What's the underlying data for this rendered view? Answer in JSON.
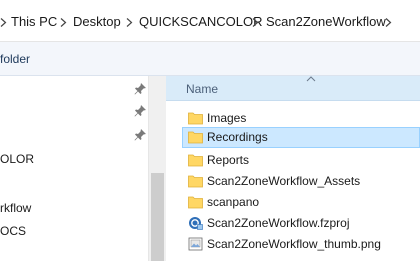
{
  "breadcrumb": [
    "This PC",
    "Desktop",
    "QUICKSCANCOLOR",
    "Scan2ZoneWorkflow"
  ],
  "command_bar": {
    "label": "folder"
  },
  "nav": {
    "items": [
      "OLOR",
      "rkflow",
      "OCS"
    ]
  },
  "file_list": {
    "column_header": "Name",
    "sort": "ascending",
    "items": [
      {
        "name": "Images",
        "icon": "folder-icon",
        "selected": false
      },
      {
        "name": "Recordings",
        "icon": "folder-icon",
        "selected": true
      },
      {
        "name": "Reports",
        "icon": "folder-icon",
        "selected": false
      },
      {
        "name": "Scan2ZoneWorkflow_Assets",
        "icon": "folder-icon",
        "selected": false
      },
      {
        "name": "scanpano",
        "icon": "folder-icon",
        "selected": false
      },
      {
        "name": "Scan2ZoneWorkflow.fzproj",
        "icon": "project-file-icon",
        "selected": false
      },
      {
        "name": "Scan2ZoneWorkflow_thumb.png",
        "icon": "image-file-icon",
        "selected": false
      }
    ]
  },
  "colors": {
    "header_bg": "#d9ebf9",
    "selection_bg": "#cce8ff",
    "selection_border": "#99d1ff",
    "folder": "#ffd764"
  }
}
